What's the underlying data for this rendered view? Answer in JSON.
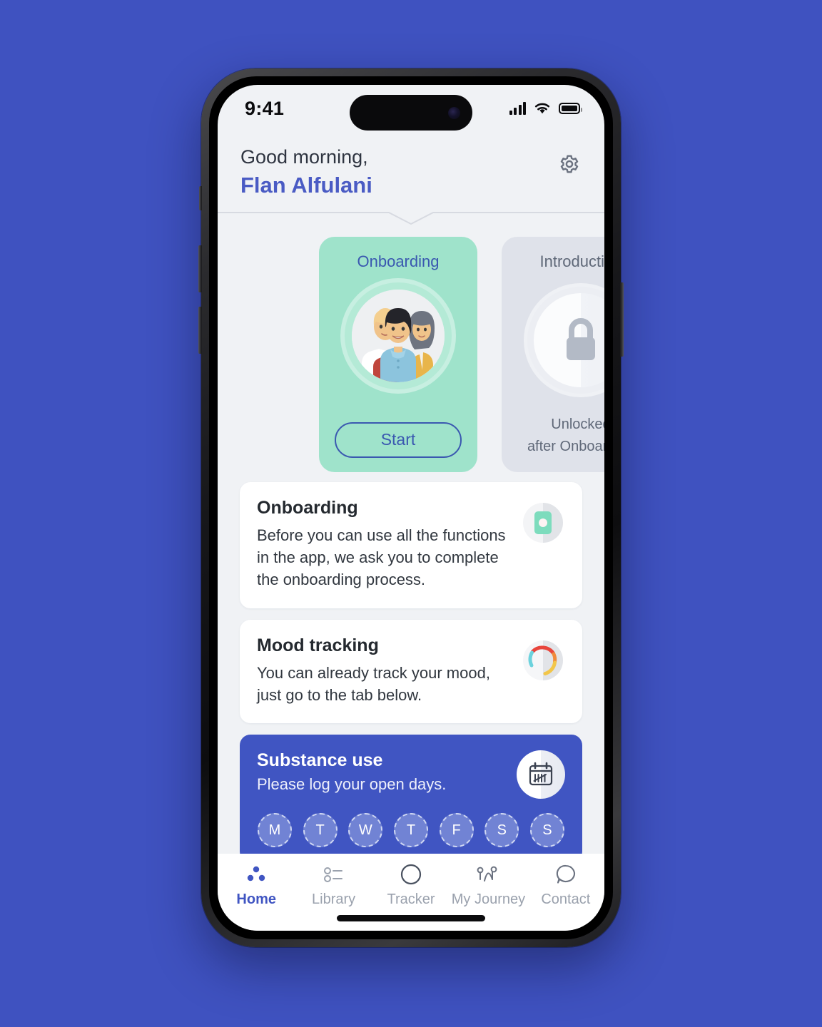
{
  "status_bar": {
    "time": "9:41",
    "signal_icon": "cellular-signal-icon",
    "wifi_icon": "wifi-icon",
    "battery_icon": "battery-icon"
  },
  "header": {
    "greeting": "Good morning,",
    "username": "Flan Alfulani",
    "settings_icon": "gear-icon",
    "username_color": "#4a5bc4"
  },
  "carousel": {
    "cards": [
      {
        "title": "Onboarding",
        "button_label": "Start",
        "illustration": "three-people-illustration",
        "background_color": "#9fe3cb",
        "locked": false
      },
      {
        "title": "Introduction",
        "note_line1": "Unlocked",
        "note_line2": "after Onboarding",
        "illustration": "lock-icon",
        "background_color": "#dfe2ea",
        "locked": true
      }
    ]
  },
  "info_cards": [
    {
      "title": "Onboarding",
      "body": "Before you can use all the functions in the app, we ask you to complete the onboarding process.",
      "icon": "door-progress-icon",
      "icon_color": "#7ddcbd"
    },
    {
      "title": "Mood tracking",
      "body": "You can already track your mood, just go to the tab below.",
      "icon": "mood-donut-icon",
      "icon_colors": [
        "#e8453c",
        "#f08a3c",
        "#f2c64a",
        "#6cd2dd"
      ]
    }
  ],
  "substance_card": {
    "title": "Substance use",
    "body": "Please log your open days.",
    "icon": "calendar-tally-icon",
    "background_color": "#4055c2",
    "days": [
      "M",
      "T",
      "W",
      "T",
      "F",
      "S",
      "S"
    ]
  },
  "tabbar": {
    "tabs": [
      {
        "label": "Home",
        "icon": "dots-home-icon",
        "active": true
      },
      {
        "label": "Library",
        "icon": "list-library-icon",
        "active": false
      },
      {
        "label": "Tracker",
        "icon": "circle-tracker-icon",
        "active": false
      },
      {
        "label": "My Journey",
        "icon": "path-journey-icon",
        "active": false
      },
      {
        "label": "Contact",
        "icon": "speech-bubble-icon",
        "active": false
      }
    ],
    "active_color": "#4055c2",
    "inactive_color": "#9aa1ad"
  }
}
